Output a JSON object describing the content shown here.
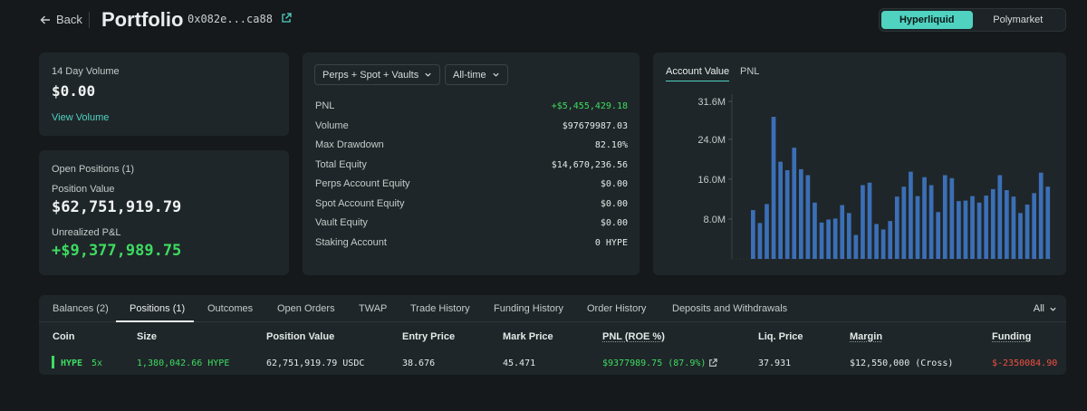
{
  "header": {
    "back_label": "Back",
    "title": "Portfolio",
    "address": "0x082e...ca88",
    "toggle": [
      "Hyperliquid",
      "Polymarket"
    ]
  },
  "volume": {
    "label": "14 Day Volume",
    "value": "$0.00",
    "link": "View Volume"
  },
  "positions": {
    "label": "Open Positions (1)",
    "value_label": "Position Value",
    "value": "$62,751,919.79",
    "upnl_label": "Unrealized P&L",
    "upnl": "+$9,377,989.75"
  },
  "stats": {
    "filter": "Perps + Spot + Vaults",
    "range": "All-time",
    "rows": [
      {
        "k": "PNL",
        "v": "+$5,455,429.18"
      },
      {
        "k": "Volume",
        "v": "$97679987.03"
      },
      {
        "k": "Max Drawdown",
        "v": "82.10%"
      },
      {
        "k": "Total Equity",
        "v": "$14,670,236.56"
      },
      {
        "k": "Perps Account Equity",
        "v": "$0.00"
      },
      {
        "k": "Spot Account Equity",
        "v": "$0.00"
      },
      {
        "k": "Vault Equity",
        "v": "$0.00"
      },
      {
        "k": "Staking Account",
        "v": "0 HYPE"
      }
    ]
  },
  "chart_tabs": [
    "Account Value",
    "PNL"
  ],
  "chart_data": {
    "type": "bar",
    "ylabel": "",
    "ylim": [
      0,
      31.6
    ],
    "yticks": [
      "31.6M",
      "24.0M",
      "16.0M",
      "8.0M"
    ],
    "ytick_values": [
      31.6,
      24.0,
      16.0,
      8.0
    ],
    "bar_color": "#3b6fb6",
    "unit": "M",
    "values": [
      9.8,
      7.2,
      11.0,
      28.5,
      19.5,
      17.8,
      22.3,
      18.0,
      16.8,
      11.3,
      7.3,
      7.9,
      8.1,
      10.8,
      9.2,
      4.8,
      14.8,
      15.3,
      7.0,
      5.9,
      7.6,
      12.5,
      14.5,
      17.5,
      12.6,
      16.4,
      14.8,
      9.4,
      16.8,
      16.2,
      11.6,
      11.7,
      12.6,
      11.3,
      12.7,
      14.0,
      16.8,
      13.8,
      12.5,
      9.2,
      10.9,
      13.2,
      17.3,
      14.5
    ]
  },
  "table": {
    "tabs": [
      "Balances (2)",
      "Positions (1)",
      "Outcomes",
      "Open Orders",
      "TWAP",
      "Trade History",
      "Funding History",
      "Order History",
      "Deposits and Withdrawals"
    ],
    "filter": "All",
    "columns": [
      "Coin",
      "Size",
      "Position Value",
      "Entry Price",
      "Mark Price",
      "PNL (ROE %)",
      "Liq. Price",
      "Margin",
      "Funding"
    ],
    "row": {
      "coin": "HYPE",
      "leverage": "5x",
      "size": "1,380,042.66 HYPE",
      "position_value": "62,751,919.79 USDC",
      "entry": "38.676",
      "mark": "45.471",
      "pnl": "$9377989.75 (87.9%)",
      "liq": "37.931",
      "margin": "$12,550,000 (Cross)",
      "funding": "$-2350084.90"
    }
  }
}
